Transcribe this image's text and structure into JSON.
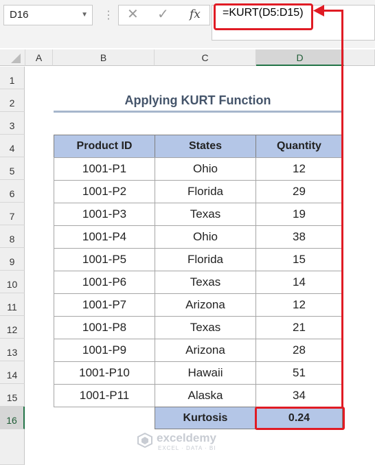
{
  "name_box": "D16",
  "formula": "=KURT(D5:D15)",
  "columns": [
    "A",
    "B",
    "C",
    "D"
  ],
  "rows": [
    "1",
    "2",
    "3",
    "4",
    "5",
    "6",
    "7",
    "8",
    "9",
    "10",
    "11",
    "12",
    "13",
    "14",
    "15",
    "16"
  ],
  "title": "Applying KURT Function",
  "table": {
    "headers": [
      "Product ID",
      "States",
      "Quantity"
    ],
    "rows": [
      [
        "1001-P1",
        "Ohio",
        "12"
      ],
      [
        "1001-P2",
        "Florida",
        "29"
      ],
      [
        "1001-P3",
        "Texas",
        "19"
      ],
      [
        "1001-P4",
        "Ohio",
        "38"
      ],
      [
        "1001-P5",
        "Florida",
        "15"
      ],
      [
        "1001-P6",
        "Texas",
        "14"
      ],
      [
        "1001-P7",
        "Arizona",
        "12"
      ],
      [
        "1001-P8",
        "Texas",
        "21"
      ],
      [
        "1001-P9",
        "Arizona",
        "28"
      ],
      [
        "1001-P10",
        "Hawaii",
        "51"
      ],
      [
        "1001-P11",
        "Alaska",
        "34"
      ]
    ]
  },
  "summary": {
    "label": "Kurtosis",
    "value": "0.24"
  },
  "watermark": {
    "name": "exceldemy",
    "tagline": "EXCEL · DATA · BI"
  },
  "icons": {
    "cancel": "close-icon",
    "enter": "check-icon",
    "fx": "fx-icon"
  },
  "colors": {
    "header_fill": "#b4c6e7",
    "highlight": "#e01b24",
    "title": "#44546a"
  }
}
